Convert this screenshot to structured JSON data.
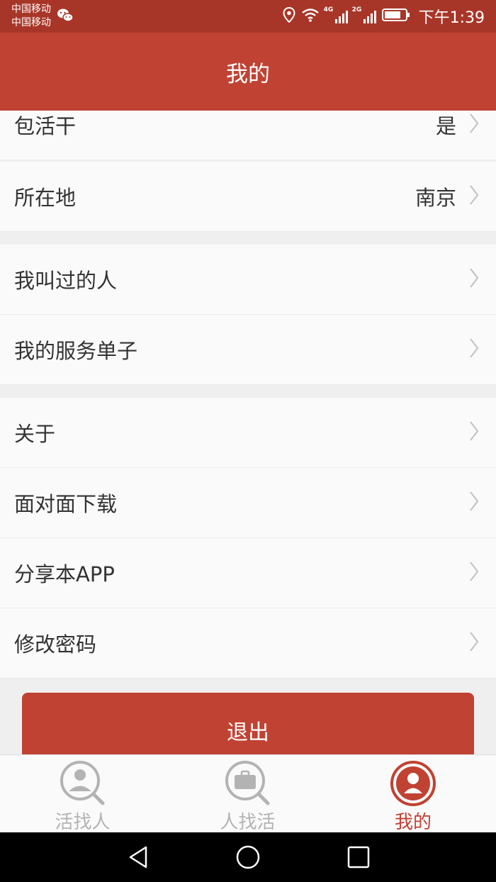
{
  "status_bar": {
    "carrier_1": "中国移动",
    "carrier_2": "中国移动",
    "network_1": "4G",
    "network_2": "2G",
    "time": "下午1:39",
    "icons": [
      "wechat-icon",
      "location-icon",
      "wifi-icon",
      "signal-icon",
      "battery-icon"
    ]
  },
  "header": {
    "title": "我的"
  },
  "settings": {
    "contract_work": {
      "label": "包活干",
      "value": "是"
    },
    "location": {
      "label": "所在地",
      "value": "南京"
    },
    "people_called": {
      "label": "我叫过的人"
    },
    "service_orders": {
      "label": "我的服务单子"
    },
    "about": {
      "label": "关于"
    },
    "face_download": {
      "label": "面对面下载"
    },
    "share_app": {
      "label": "分享本APP"
    },
    "change_password": {
      "label": "修改密码"
    }
  },
  "logout_label": "退出",
  "tabs": [
    {
      "label": "活找人",
      "icon": "person-search-icon",
      "active": false
    },
    {
      "label": "人找活",
      "icon": "briefcase-search-icon",
      "active": false
    },
    {
      "label": "我的",
      "icon": "profile-icon",
      "active": true
    }
  ],
  "colors": {
    "status_bar": "#a83628",
    "primary": "#c04233",
    "tab_inactive": "#b3b3b3",
    "page_bg": "#f0efef",
    "row_bg": "#fafafa"
  }
}
